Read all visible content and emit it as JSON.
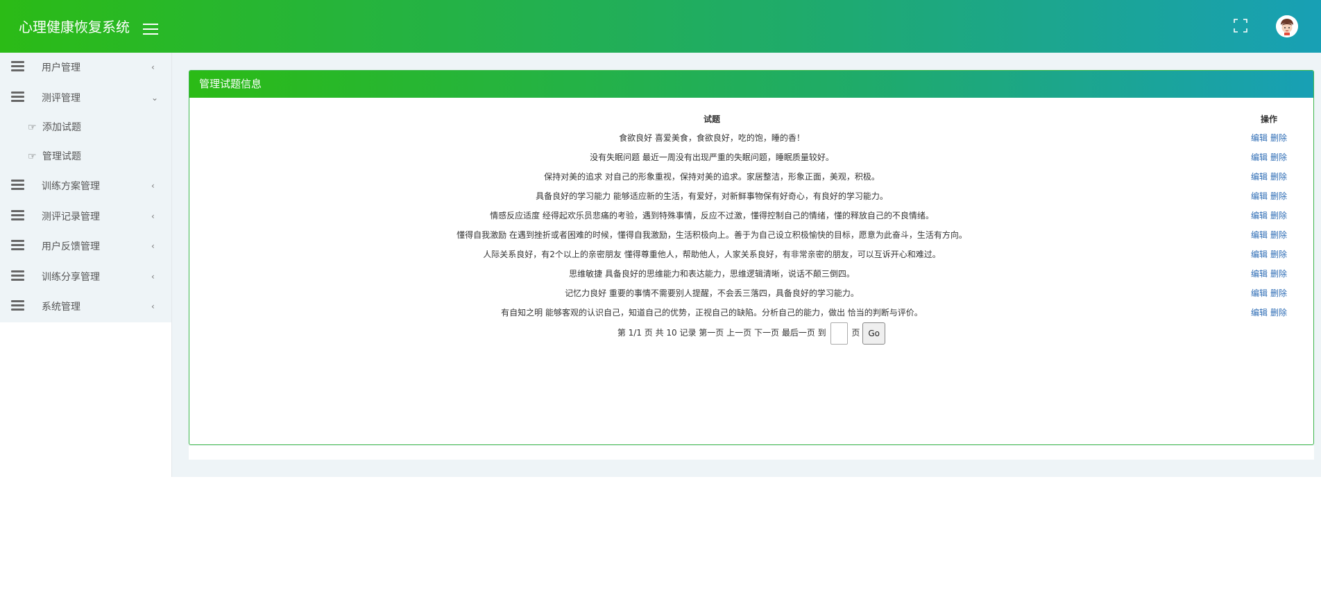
{
  "app": {
    "title": "心理健康恢复系统"
  },
  "sidebar": {
    "items": [
      {
        "label": "用户管理",
        "chevron": "‹"
      },
      {
        "label": "测评管理",
        "chevron": "⌄",
        "children": [
          {
            "label": "添加试题"
          },
          {
            "label": "管理试题"
          }
        ]
      },
      {
        "label": "训练方案管理",
        "chevron": "‹"
      },
      {
        "label": "测评记录管理",
        "chevron": "‹"
      },
      {
        "label": "用户反馈管理",
        "chevron": "‹"
      },
      {
        "label": "训练分享管理",
        "chevron": "‹"
      },
      {
        "label": "系统管理",
        "chevron": "‹"
      }
    ]
  },
  "panel": {
    "title": "管理试题信息",
    "columns": {
      "question": "试题",
      "actions": "操作"
    },
    "edit_label": "编辑",
    "delete_label": "删除",
    "rows": [
      "食欲良好 喜爱美食，食欲良好，吃的饱，睡的香！",
      "没有失眠问题 最近一周没有出现严重的失眠问题，睡眠质量较好。",
      "保持对美的追求 对自己的形象重视，保持对美的追求。家居整洁，形象正面，美观，积极。",
      "具备良好的学习能力 能够适应新的生活，有爱好，对新鲜事物保有好奇心，有良好的学习能力。",
      "情感反应适度 经得起欢乐员悲痛的考验，遇到特殊事情，反应不过激，懂得控制自己的情绪，懂的释放自己的不良情绪。",
      "懂得自我激励 在遇到挫折或者困难的时候，懂得自我激励，生活积极向上。善于为自己设立积极愉快的目标，愿意为此奋斗，生活有方向。",
      "人际关系良好，有2个以上的亲密朋友 懂得尊重他人，帮助他人，人家关系良好，有非常亲密的朋友，可以互诉开心和难过。",
      "思维敏捷 具备良好的思维能力和表达能力，思维逻辑清晰，说话不颠三倒四。",
      "记忆力良好 重要的事情不需要别人提醒，不会丢三落四，具备良好的学习能力。",
      "有自知之明 能够客观的认识自己，知道自己的优势，正视自己的缺陷。分析自己的能力，做出 恰当的判断与评价。"
    ]
  },
  "pager": {
    "summary": "第 1/1 页 共 10 记录",
    "first": "第一页",
    "prev": "上一页",
    "next": "下一页",
    "last": "最后一页",
    "goto_prefix": "到",
    "goto_suffix": "页",
    "go_label": "Go",
    "page_input_value": ""
  },
  "colors": {
    "accent_green": "#2bbb16",
    "accent_teal": "#18a0b5",
    "link": "#2d6cb5"
  },
  "icons": {
    "menu": "hamburger-icon",
    "fullscreen": "fullscreen-icon",
    "avatar": "avatar-icon"
  }
}
